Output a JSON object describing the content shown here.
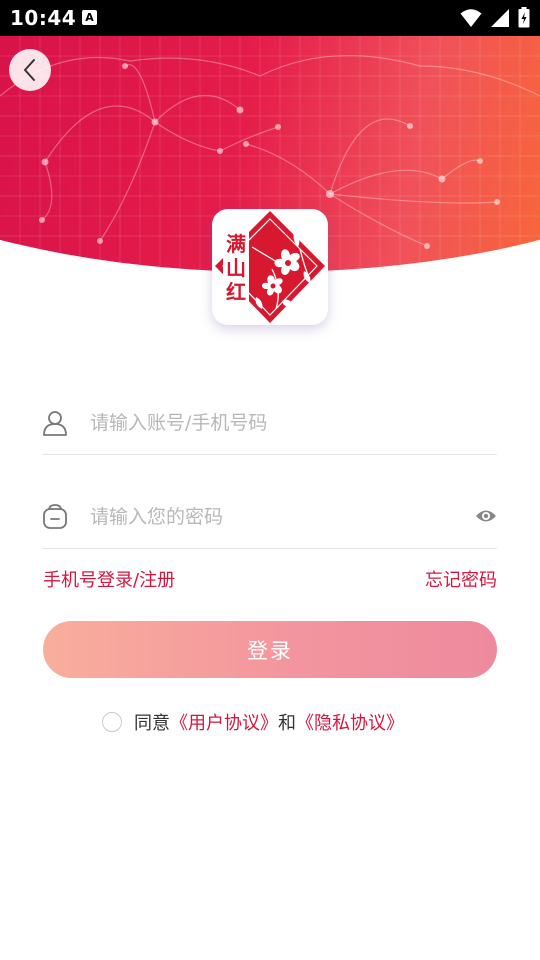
{
  "status_bar": {
    "time": "10:44",
    "notification_badge": "A",
    "icons": [
      "wifi-icon",
      "signal-icon",
      "battery-icon"
    ]
  },
  "colors": {
    "brand_red": "#d4173f",
    "header_gradient": [
      "#d9124a",
      "#e51d4a",
      "#f0515a",
      "#f8663a"
    ],
    "button_gradient": [
      "#f9ae9c",
      "#f3959e",
      "#ee8a9e"
    ]
  },
  "header": {
    "back_icon": "chevron-left-icon",
    "logo_text": "满山红"
  },
  "form": {
    "account_placeholder": "请输入账号/手机号码",
    "account_value": "",
    "password_placeholder": "请输入您的密码",
    "password_value": "",
    "phone_login_link": "手机号登录/注册",
    "forgot_password_link": "忘记密码",
    "login_button": "登录"
  },
  "agreement": {
    "checked": false,
    "prefix": "同意",
    "user_agreement": "《用户协议》",
    "and": "和",
    "privacy_agreement": "《隐私协议》"
  }
}
